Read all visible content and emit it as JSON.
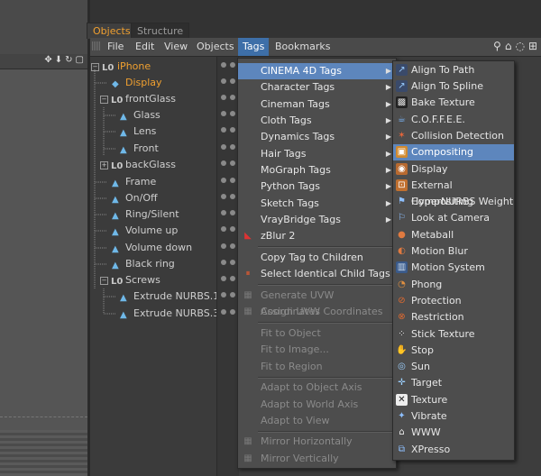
{
  "panel_tabs": {
    "objects": "Objects",
    "structure": "Structure"
  },
  "menubar": {
    "file": "File",
    "edit": "Edit",
    "view": "View",
    "objects": "Objects",
    "tags": "Tags",
    "bookmarks": "Bookmarks"
  },
  "tree": {
    "iphone": "iPhone",
    "display": "Display",
    "frontglass": "frontGlass",
    "glass": "Glass",
    "lens": "Lens",
    "front": "Front",
    "backglass": "backGlass",
    "frame": "Frame",
    "onoff": "On/Off",
    "ringsilent": "Ring/Silent",
    "volumeup": "Volume up",
    "volumedown": "Volume down",
    "blackring": "Black ring",
    "screws": "Screws",
    "extrude1": "Extrude NURBS.1",
    "extrude3": "Extrude NURBS.3"
  },
  "tags_menu": {
    "cinema4d": "CINEMA 4D Tags",
    "character": "Character Tags",
    "cineman": "Cineman Tags",
    "cloth": "Cloth Tags",
    "dynamics": "Dynamics Tags",
    "hair": "Hair Tags",
    "mograph": "MoGraph Tags",
    "python": "Python Tags",
    "sketch": "Sketch Tags",
    "vraybridge": "VrayBridge Tags",
    "zblur": "zBlur 2",
    "copytag": "Copy Tag to Children",
    "selectidentical": "Select Identical Child Tags",
    "generateuvw": "Generate UVW Coordinates",
    "assignuvw": "Assign UVW Coordinates",
    "fitobject": "Fit to Object",
    "fitimage": "Fit to Image...",
    "fitregion": "Fit to Region",
    "adaptobject": "Adapt to Object Axis",
    "adaptworld": "Adapt to World Axis",
    "adaptview": "Adapt to View",
    "mirrorh": "Mirror Horizontally",
    "mirrorv": "Mirror Vertically"
  },
  "c4d_tags": [
    "Align To Path",
    "Align To Spline",
    "Bake Texture",
    "C.O.F.F.E.E.",
    "Collision Detection",
    "Compositing",
    "Display",
    "External Compositing",
    "HyperNURBS Weight",
    "Look at Camera",
    "Metaball",
    "Motion Blur",
    "Motion System",
    "Phong",
    "Protection",
    "Restriction",
    "Stick Texture",
    "Stop",
    "Sun",
    "Target",
    "Texture",
    "Vibrate",
    "WWW",
    "XPresso"
  ],
  "colors": {
    "highlight": "#5d86bd",
    "active_tab": "#f0a030",
    "menu_bg": "#4d4d4d"
  }
}
